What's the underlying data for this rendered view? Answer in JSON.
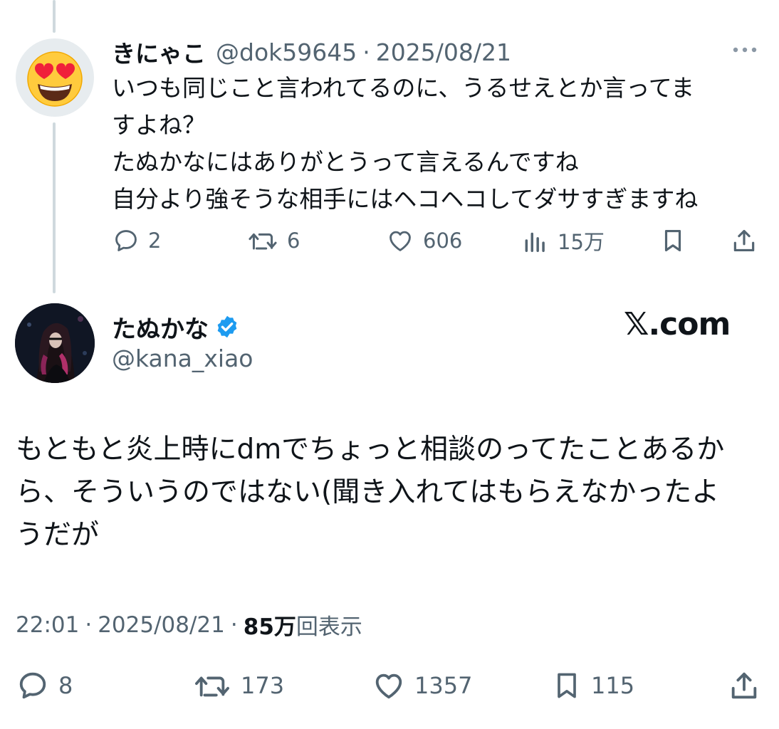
{
  "reply_tweet": {
    "display_name": "きにゃこ",
    "handle": "@dok59645",
    "separator": "·",
    "date": "2025/08/21",
    "avatar_icon": "heart-eyes-emoji-icon",
    "text_lines": [
      "いつも同じこと言われてるのに、うるせえとか言ってま",
      "すよね？",
      "たぬかなにはありがとうって言えるんですね",
      "自分より強そうな相手にはヘコヘコしてダサすぎますね"
    ],
    "actions": {
      "replies": "2",
      "retweets": "6",
      "likes": "606",
      "views": "15万"
    }
  },
  "main_tweet": {
    "display_name": "たぬかな",
    "handle": "@kana_xiao",
    "verified": true,
    "watermark": "𝕏.com",
    "text_lines": [
      "もともと炎上時にdmでちょっと相談のってたことあるか",
      "ら、そういうのではない(聞き入れてはもらえなかったよ",
      "うだが"
    ],
    "time": "22:01",
    "separator": "·",
    "date": "2025/08/21",
    "views_count": "85万",
    "views_label": "回表示",
    "actions": {
      "replies": "8",
      "retweets": "173",
      "likes": "1357",
      "bookmarks": "115"
    }
  },
  "colors": {
    "text": "#0f1419",
    "muted": "#536471",
    "verified": "#1d9bf0",
    "thread_line": "#cfd9de"
  }
}
